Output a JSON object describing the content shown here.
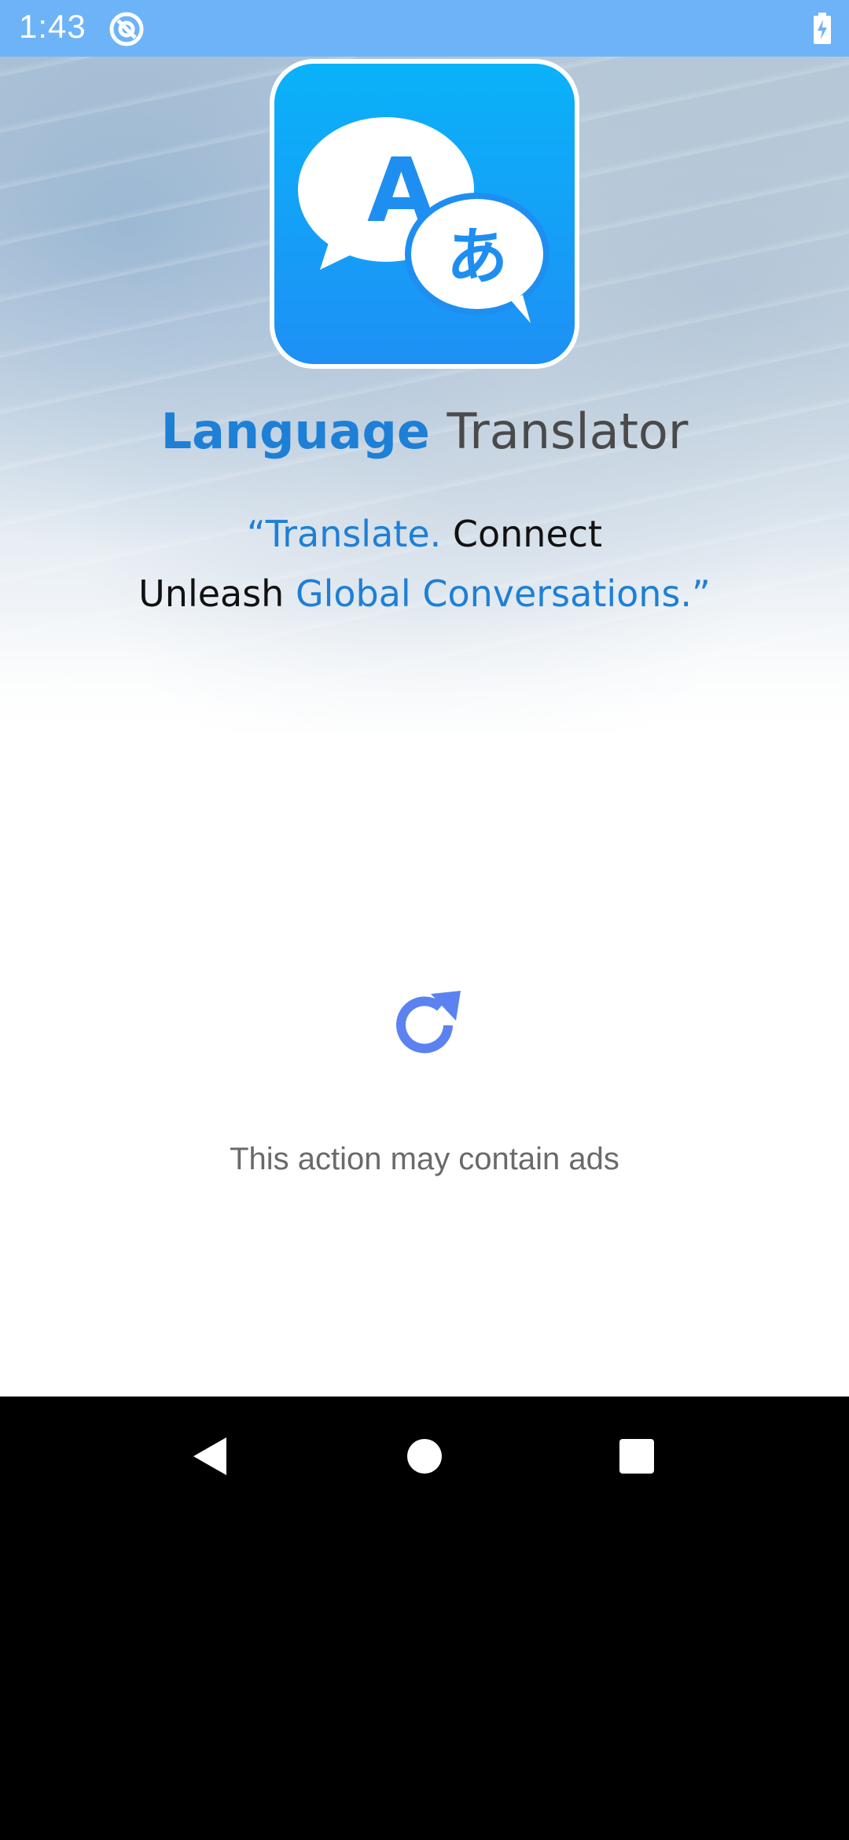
{
  "status_bar": {
    "time": "1:43",
    "app_icon": "at-sign-icon",
    "battery_icon": "battery-charging-icon",
    "background_color": "#6db3f8"
  },
  "hero": {
    "logo_icon": "translate-bubbles-icon",
    "logo_glyph_latin": "A",
    "logo_glyph_japanese": "あ",
    "title_part1": "Language",
    "title_part2": "Translator",
    "tagline_line1_blue": "“Translate.",
    "tagline_line1_black": "Connect",
    "tagline_line2_black": "Unleash",
    "tagline_line2_blue": "Global Conversations.”",
    "accent_color": "#1e7fd6",
    "logo_gradient_top": "#0ab2f9",
    "logo_gradient_bottom": "#1e90f5"
  },
  "loading": {
    "icon": "refresh-icon",
    "icon_color": "#5b82f0",
    "notice": "This action may contain ads"
  },
  "nav_bar": {
    "back_icon": "back-triangle-icon",
    "home_icon": "home-circle-icon",
    "recents_icon": "recents-square-icon"
  }
}
